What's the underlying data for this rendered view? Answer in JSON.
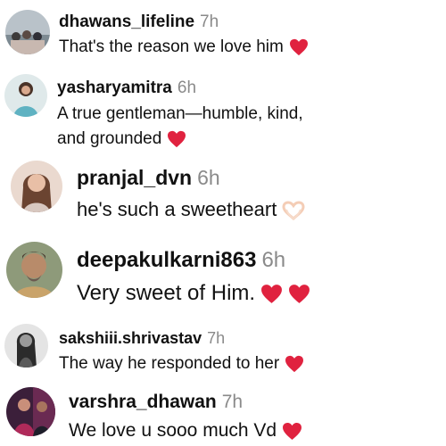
{
  "comments": [
    {
      "username": "dhawans_lifeline",
      "time": "7h",
      "text": "That's the reason we love him",
      "emoji": [
        "red-heart"
      ]
    },
    {
      "username": "yasharyamitra",
      "time": "6h",
      "text_line1": "A true gentleman—humble, kind,",
      "text_line2": "and grounded",
      "emoji": [
        "red-heart"
      ]
    },
    {
      "username": "pranjal_dvn",
      "time": "6h",
      "text": "he's such a sweetheart",
      "emoji": [
        "heart-hands"
      ]
    },
    {
      "username": "deepakulkarni863",
      "time": "6h",
      "text": "Very sweet of Him.",
      "emoji": [
        "red-heart",
        "red-heart"
      ]
    },
    {
      "username": "sakshiii.shrivastav",
      "time": "7h",
      "text": "The way he responded to her",
      "emoji": [
        "red-heart"
      ]
    },
    {
      "username": "varshra_dhawan",
      "time": "7h",
      "text": "We love u sooo much Vd",
      "emoji": [
        "red-heart"
      ]
    }
  ],
  "colors": {
    "heart": "#e0223f",
    "timestamp": "#8a8a8a",
    "text": "#111111"
  }
}
